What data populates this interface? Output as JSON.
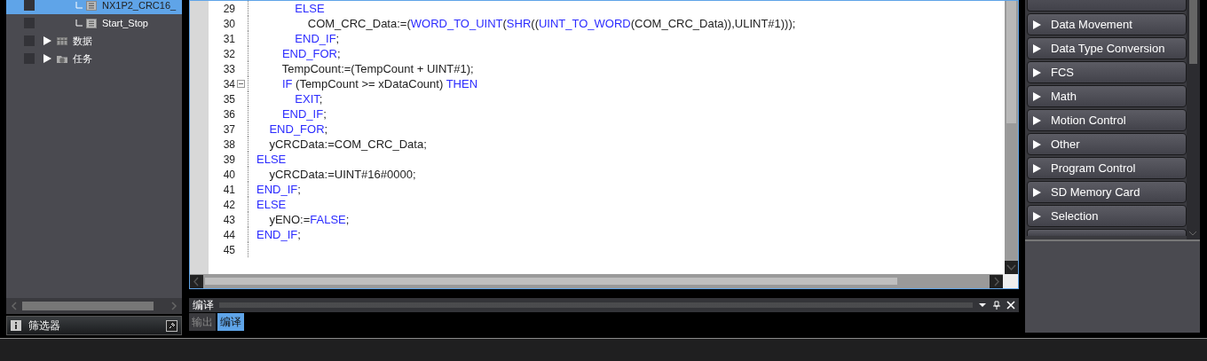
{
  "project_tree": {
    "items": [
      {
        "label": "NX1P2_CRC16_",
        "kind": "program",
        "branch": true,
        "selected": true
      },
      {
        "label": "Start_Stop",
        "kind": "program",
        "branch": true,
        "selected": false
      },
      {
        "label": "数据",
        "kind": "table",
        "branch": false,
        "selected": false
      },
      {
        "label": "任务",
        "kind": "folder",
        "branch": false,
        "selected": false
      }
    ],
    "filter": {
      "label": "筛选器"
    }
  },
  "editor": {
    "lines": [
      {
        "number": "29",
        "fold_marker": false,
        "tokens": [
          {
            "text": "            ELSE",
            "kind": "keyword"
          }
        ]
      },
      {
        "number": "30",
        "fold_marker": false,
        "tokens": [
          {
            "text": "                COM_CRC_Data:=(",
            "kind": "plain"
          },
          {
            "text": "WORD_TO_UINT",
            "kind": "keyword"
          },
          {
            "text": "(",
            "kind": "plain"
          },
          {
            "text": "SHR",
            "kind": "keyword"
          },
          {
            "text": "((",
            "kind": "plain"
          },
          {
            "text": "UINT_TO_WORD",
            "kind": "keyword"
          },
          {
            "text": "(COM_CRC_Data)),ULINT#1)));",
            "kind": "plain"
          }
        ]
      },
      {
        "number": "31",
        "fold_marker": false,
        "tokens": [
          {
            "text": "            END_IF",
            "kind": "keyword"
          },
          {
            "text": ";",
            "kind": "plain"
          }
        ]
      },
      {
        "number": "32",
        "fold_marker": false,
        "tokens": [
          {
            "text": "        END_FOR",
            "kind": "keyword"
          },
          {
            "text": ";",
            "kind": "plain"
          }
        ]
      },
      {
        "number": "33",
        "fold_marker": false,
        "tokens": [
          {
            "text": "        TempCount:=(TempCount + UINT#1);",
            "kind": "plain"
          }
        ]
      },
      {
        "number": "34",
        "fold_marker": true,
        "tokens": [
          {
            "text": "        IF",
            "kind": "keyword"
          },
          {
            "text": " (TempCount >= xDataCount) ",
            "kind": "plain"
          },
          {
            "text": "THEN",
            "kind": "keyword"
          }
        ]
      },
      {
        "number": "35",
        "fold_marker": false,
        "tokens": [
          {
            "text": "            EXIT",
            "kind": "keyword"
          },
          {
            "text": ";",
            "kind": "plain"
          }
        ]
      },
      {
        "number": "36",
        "fold_marker": false,
        "tokens": [
          {
            "text": "        END_IF",
            "kind": "keyword"
          },
          {
            "text": ";",
            "kind": "plain"
          }
        ]
      },
      {
        "number": "37",
        "fold_marker": false,
        "tokens": [
          {
            "text": "    END_FOR",
            "kind": "keyword"
          },
          {
            "text": ";",
            "kind": "plain"
          }
        ]
      },
      {
        "number": "38",
        "fold_marker": false,
        "tokens": [
          {
            "text": "    yCRCData:=COM_CRC_Data;",
            "kind": "plain"
          }
        ]
      },
      {
        "number": "39",
        "fold_marker": false,
        "tokens": [
          {
            "text": "ELSE",
            "kind": "keyword"
          }
        ]
      },
      {
        "number": "40",
        "fold_marker": false,
        "tokens": [
          {
            "text": "    yCRCData:=UINT#16#0000;",
            "kind": "plain"
          }
        ]
      },
      {
        "number": "41",
        "fold_marker": false,
        "tokens": [
          {
            "text": "END_IF",
            "kind": "keyword"
          },
          {
            "text": ";",
            "kind": "plain"
          }
        ]
      },
      {
        "number": "42",
        "fold_marker": false,
        "tokens": [
          {
            "text": "ELSE",
            "kind": "keyword"
          }
        ]
      },
      {
        "number": "43",
        "fold_marker": false,
        "tokens": [
          {
            "text": "    yENO:=",
            "kind": "plain"
          },
          {
            "text": "FALSE",
            "kind": "keyword"
          },
          {
            "text": ";",
            "kind": "plain"
          }
        ]
      },
      {
        "number": "44",
        "fold_marker": false,
        "tokens": [
          {
            "text": "END_IF",
            "kind": "keyword"
          },
          {
            "text": ";",
            "kind": "plain"
          }
        ]
      },
      {
        "number": "45",
        "fold_marker": false
      }
    ]
  },
  "output_panel": {
    "title": "编译",
    "tabs": [
      {
        "label": "输出",
        "selected": false
      },
      {
        "label": "编译",
        "selected": true
      }
    ]
  },
  "toolbox": {
    "groups": [
      "Data Movement",
      "Data Type Conversion",
      "FCS",
      "Math",
      "Motion Control",
      "Other",
      "Program Control",
      "SD Memory Card",
      "Selection"
    ]
  }
}
